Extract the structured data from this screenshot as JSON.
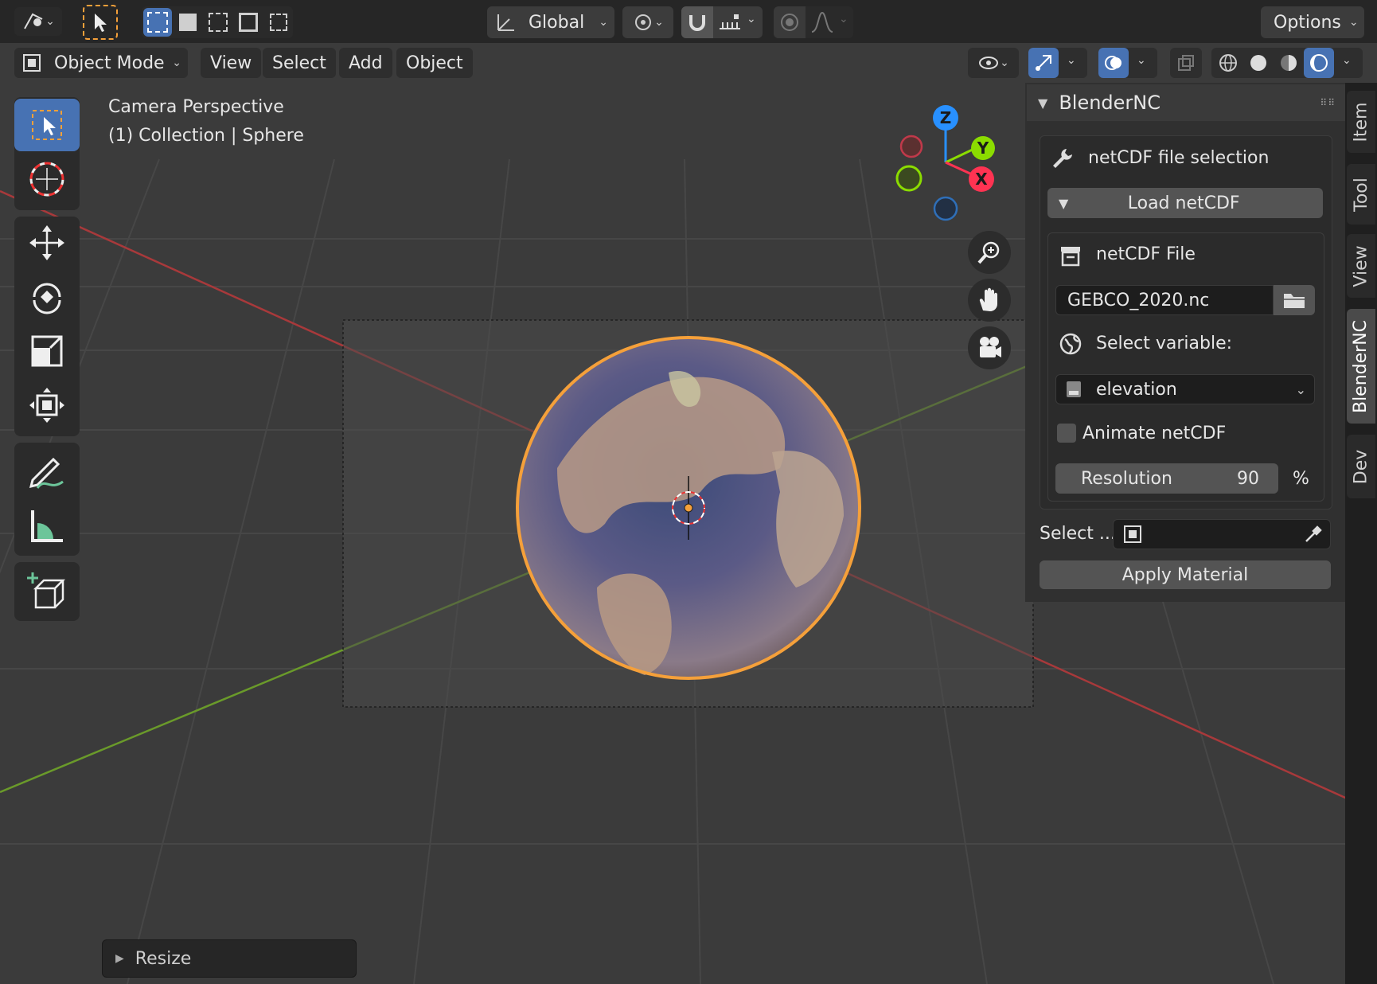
{
  "header": {
    "transform_orientation": "Global",
    "options_label": "Options",
    "mode_label": "Object Mode",
    "menus": [
      "View",
      "Select",
      "Add",
      "Object"
    ]
  },
  "viewport": {
    "camera_label": "Camera Perspective",
    "collection_label": "(1) Collection | Sphere",
    "gizmo": {
      "z": "Z",
      "y": "Y",
      "x": "X"
    }
  },
  "panel": {
    "title": "BlenderNC",
    "subpanel_title": "netCDF file selection",
    "load_label": "Load netCDF",
    "file_label": "netCDF File",
    "file_value": "GEBCO_2020.nc",
    "select_variable_label": "Select variable:",
    "variable_value": "elevation",
    "animate_label": "Animate netCDF",
    "animate_checked": false,
    "resolution_label": "Resolution",
    "resolution_value": "90",
    "resolution_unit": "%",
    "select_label": "Select ...",
    "apply_label": "Apply Material"
  },
  "tabs": [
    "Item",
    "Tool",
    "View",
    "BlenderNC",
    "Dev"
  ],
  "active_tab": "BlenderNC",
  "last_operator": "Resize",
  "colors": {
    "accent_blue": "#4772b3",
    "selection_orange": "#f5a03a",
    "axis_x": "#ff3352",
    "axis_y": "#8bdc00",
    "axis_z": "#2890ff",
    "grid_x_line": "#b03a3a",
    "grid_y_line": "#6a9a2a"
  }
}
